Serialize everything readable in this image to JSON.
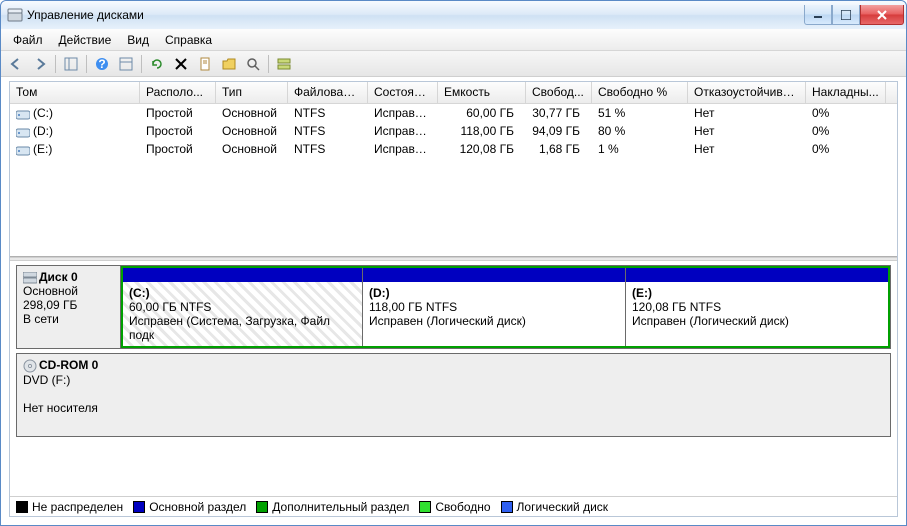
{
  "window": {
    "title": "Управление дисками"
  },
  "menu": {
    "file": "Файл",
    "action": "Действие",
    "view": "Вид",
    "help": "Справка"
  },
  "columns": [
    "Том",
    "Располо...",
    "Тип",
    "Файловая с...",
    "Состояние",
    "Емкость",
    "Свобод...",
    "Свободно %",
    "Отказоустойчиво...",
    "Накладны..."
  ],
  "volumes": [
    {
      "name": "(C:)",
      "layout": "Простой",
      "type": "Основной",
      "fs": "NTFS",
      "status": "Исправен...",
      "capacity": "60,00 ГБ",
      "free": "30,77 ГБ",
      "freepct": "51 %",
      "fault": "Нет",
      "over": "0%"
    },
    {
      "name": "(D:)",
      "layout": "Простой",
      "type": "Основной",
      "fs": "NTFS",
      "status": "Исправен...",
      "capacity": "118,00 ГБ",
      "free": "94,09 ГБ",
      "freepct": "80 %",
      "fault": "Нет",
      "over": "0%"
    },
    {
      "name": "(E:)",
      "layout": "Простой",
      "type": "Основной",
      "fs": "NTFS",
      "status": "Исправен...",
      "capacity": "120,08 ГБ",
      "free": "1,68 ГБ",
      "freepct": "1 %",
      "fault": "Нет",
      "over": "0%"
    }
  ],
  "disk0": {
    "label": "Диск 0",
    "type": "Основной",
    "size": "298,09 ГБ",
    "status": "В сети",
    "parts": [
      {
        "name": "(C:)",
        "size": "60,00 ГБ NTFS",
        "status": "Исправен (Система, Загрузка, Файл подк"
      },
      {
        "name": "(D:)",
        "size": "118,00 ГБ NTFS",
        "status": "Исправен (Логический диск)"
      },
      {
        "name": "(E:)",
        "size": "120,08 ГБ NTFS",
        "status": "Исправен (Логический диск)"
      }
    ]
  },
  "cdrom": {
    "label": "CD-ROM 0",
    "sub": "DVD (F:)",
    "status": "Нет носителя"
  },
  "legend": {
    "unalloc": "Не распределен",
    "primary": "Основной раздел",
    "extended": "Дополнительный раздел",
    "free": "Свободно",
    "logical": "Логический диск"
  }
}
